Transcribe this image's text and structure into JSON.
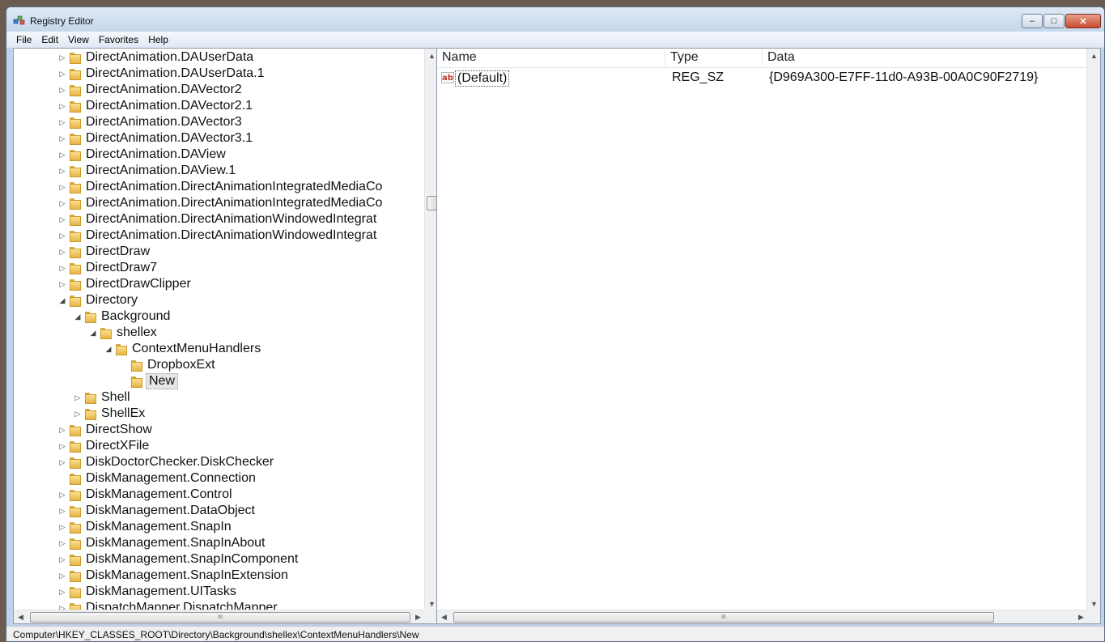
{
  "window": {
    "title": "Registry Editor",
    "controls": {
      "minimize": "–",
      "maximize": "□",
      "close": "✕"
    }
  },
  "menu": [
    "File",
    "Edit",
    "View",
    "Favorites",
    "Help"
  ],
  "tree": {
    "nodes": [
      {
        "label": "DirectAnimation.DAUserData",
        "depth": 0,
        "expander": "collapsed"
      },
      {
        "label": "DirectAnimation.DAUserData.1",
        "depth": 0,
        "expander": "collapsed"
      },
      {
        "label": "DirectAnimation.DAVector2",
        "depth": 0,
        "expander": "collapsed"
      },
      {
        "label": "DirectAnimation.DAVector2.1",
        "depth": 0,
        "expander": "collapsed"
      },
      {
        "label": "DirectAnimation.DAVector3",
        "depth": 0,
        "expander": "collapsed"
      },
      {
        "label": "DirectAnimation.DAVector3.1",
        "depth": 0,
        "expander": "collapsed"
      },
      {
        "label": "DirectAnimation.DAView",
        "depth": 0,
        "expander": "collapsed"
      },
      {
        "label": "DirectAnimation.DAView.1",
        "depth": 0,
        "expander": "collapsed"
      },
      {
        "label": "DirectAnimation.DirectAnimationIntegratedMediaCo",
        "depth": 0,
        "expander": "collapsed"
      },
      {
        "label": "DirectAnimation.DirectAnimationIntegratedMediaCo",
        "depth": 0,
        "expander": "collapsed"
      },
      {
        "label": "DirectAnimation.DirectAnimationWindowedIntegrat",
        "depth": 0,
        "expander": "collapsed"
      },
      {
        "label": "DirectAnimation.DirectAnimationWindowedIntegrat",
        "depth": 0,
        "expander": "collapsed"
      },
      {
        "label": "DirectDraw",
        "depth": 0,
        "expander": "collapsed"
      },
      {
        "label": "DirectDraw7",
        "depth": 0,
        "expander": "collapsed"
      },
      {
        "label": "DirectDrawClipper",
        "depth": 0,
        "expander": "collapsed"
      },
      {
        "label": "Directory",
        "depth": 0,
        "expander": "expanded"
      },
      {
        "label": "Background",
        "depth": 1,
        "expander": "expanded"
      },
      {
        "label": "shellex",
        "depth": 2,
        "expander": "expanded"
      },
      {
        "label": "ContextMenuHandlers",
        "depth": 3,
        "expander": "expanded"
      },
      {
        "label": "DropboxExt",
        "depth": 4,
        "expander": "none"
      },
      {
        "label": "New",
        "depth": 4,
        "expander": "none",
        "selected": true
      },
      {
        "label": "Shell",
        "depth": 1,
        "expander": "collapsed"
      },
      {
        "label": "ShellEx",
        "depth": 1,
        "expander": "collapsed"
      },
      {
        "label": "DirectShow",
        "depth": 0,
        "expander": "collapsed"
      },
      {
        "label": "DirectXFile",
        "depth": 0,
        "expander": "collapsed"
      },
      {
        "label": "DiskDoctorChecker.DiskChecker",
        "depth": 0,
        "expander": "collapsed"
      },
      {
        "label": "DiskManagement.Connection",
        "depth": 0,
        "expander": "none"
      },
      {
        "label": "DiskManagement.Control",
        "depth": 0,
        "expander": "collapsed"
      },
      {
        "label": "DiskManagement.DataObject",
        "depth": 0,
        "expander": "collapsed"
      },
      {
        "label": "DiskManagement.SnapIn",
        "depth": 0,
        "expander": "collapsed"
      },
      {
        "label": "DiskManagement.SnapInAbout",
        "depth": 0,
        "expander": "collapsed"
      },
      {
        "label": "DiskManagement.SnapInComponent",
        "depth": 0,
        "expander": "collapsed"
      },
      {
        "label": "DiskManagement.SnapInExtension",
        "depth": 0,
        "expander": "collapsed"
      },
      {
        "label": "DiskManagement.UITasks",
        "depth": 0,
        "expander": "collapsed"
      },
      {
        "label": "DispatchMapper.DispatchMapper",
        "depth": 0,
        "expander": "collapsed"
      }
    ]
  },
  "values": {
    "columns": [
      "Name",
      "Type",
      "Data"
    ],
    "rows": [
      {
        "name": "(Default)",
        "type": "REG_SZ",
        "data": "{D969A300-E7FF-11d0-A93B-00A0C90F2719}",
        "icon": "string-value-icon"
      }
    ]
  },
  "scroll": {
    "up": "▲",
    "down": "▼",
    "left": "◀",
    "right": "▶",
    "grip": "III"
  },
  "status": {
    "path": "Computer\\HKEY_CLASSES_ROOT\\Directory\\Background\\shellex\\ContextMenuHandlers\\New"
  }
}
